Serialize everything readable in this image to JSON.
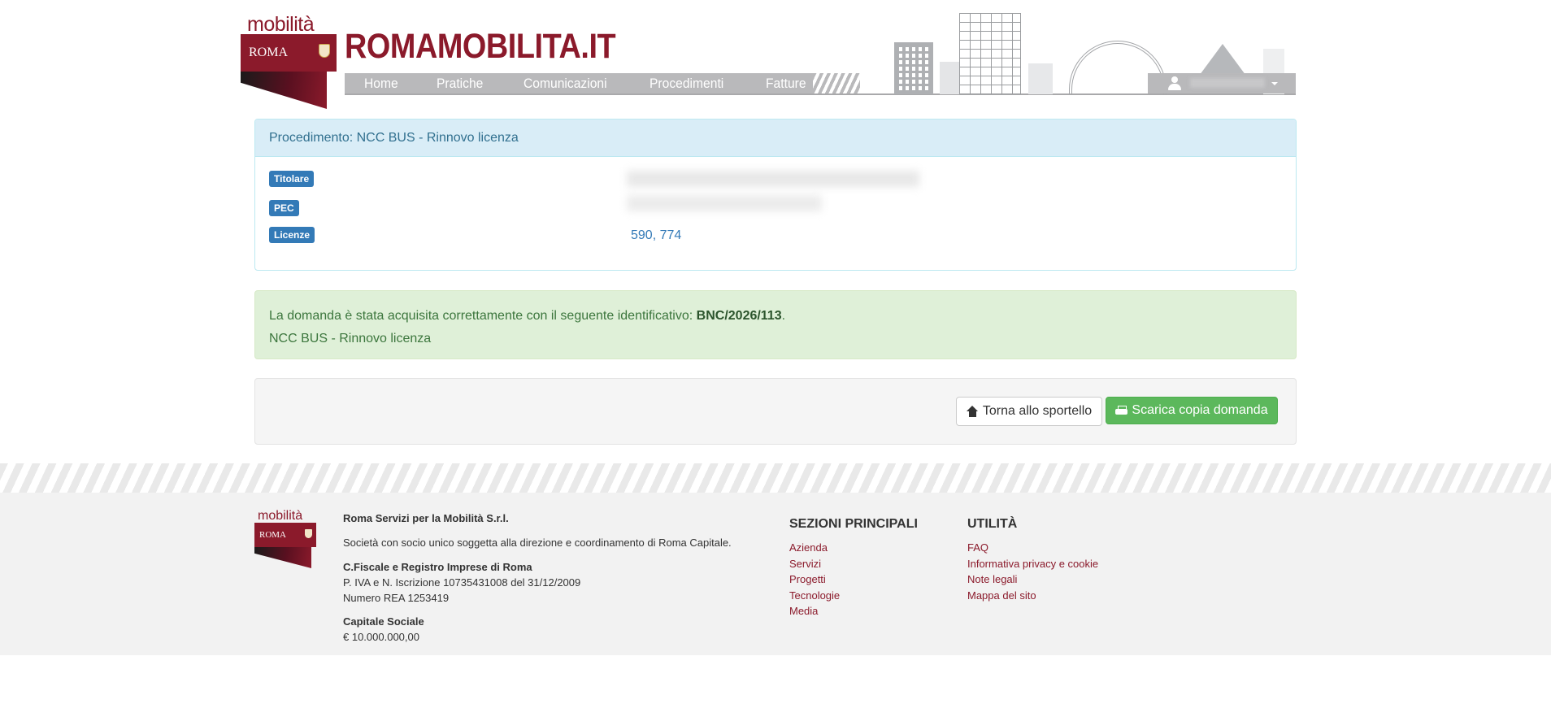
{
  "header": {
    "logo_top": "mobilità",
    "logo_band": "ROMA",
    "brand": "ROMAMOBILITA.IT",
    "nav": [
      "Home",
      "Pratiche",
      "Comunicazioni",
      "Procedimenti",
      "Fatture"
    ]
  },
  "procedure_panel": {
    "title": "Procedimento: NCC BUS - Rinnovo licenza",
    "rows": [
      {
        "label": "Titolare"
      },
      {
        "label": "PEC"
      },
      {
        "label": "Licenze",
        "value": "590, 774"
      }
    ]
  },
  "success_alert": {
    "prefix": "La domanda è stata acquisita correttamente con il seguente identificativo: ",
    "identifier": "BNC/2026/113",
    "suffix": ".",
    "subtitle": "NCC BUS - Rinnovo licenza"
  },
  "actions": {
    "back_label": "Torna allo sportello",
    "download_label": "Scarica copia domanda"
  },
  "footer": {
    "logo_top": "mobilità",
    "logo_band": "ROMA",
    "company_name": "Roma Servizi per la Mobilità S.r.l.",
    "company_desc": "Società con socio unico soggetta alla direzione e coordinamento di Roma Capitale.",
    "fiscal_title": "C.Fiscale e Registro Imprese di Roma",
    "fiscal_line1": "P. IVA e N. Iscrizione 10735431008 del 31/12/2009",
    "fiscal_line2": "Numero REA 1253419",
    "capital_title": "Capitale Sociale",
    "capital_value": "€ 10.000.000,00",
    "sections_title": "SEZIONI PRINCIPALI",
    "sections": [
      "Azienda",
      "Servizi",
      "Progetti",
      "Tecnologie",
      "Media"
    ],
    "util_title": "UTILITÀ",
    "util": [
      "FAQ",
      "Informativa privacy e cookie",
      "Note legali",
      "Mappa del sito"
    ]
  },
  "colors": {
    "brand": "#8b1a2b",
    "info_bg": "#d9edf7",
    "success_bg": "#dff0d8",
    "success_btn": "#5cb85c",
    "badge": "#337ab7"
  }
}
